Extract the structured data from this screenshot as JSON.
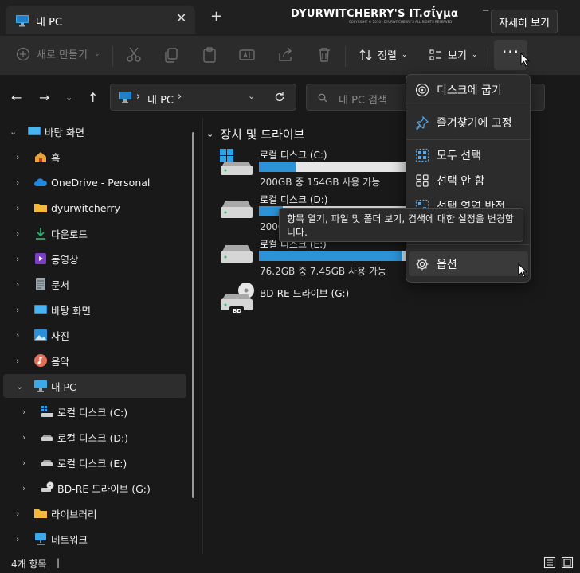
{
  "window": {
    "tab_title": "내 PC",
    "tab_close": "✕",
    "new_tab": "+",
    "brand": "DYURWITCHERRY'S IT.σΐγμα",
    "brand_sub": "COPYRIGHT © 2016 - DYURWITCHERRY'S ALL RIGHTS RESERVED",
    "tooltip_top": "자세히 보기"
  },
  "toolbar": {
    "new_label": "새로 만들기",
    "sort_label": "정렬",
    "view_label": "보기",
    "more_label": "···"
  },
  "address": {
    "location": "내 PC",
    "search_placeholder": "내 PC 검색"
  },
  "sidebar": {
    "items": [
      {
        "label": "바탕 화면",
        "icon": "desktop-icon"
      },
      {
        "label": "홈",
        "icon": "home-icon"
      },
      {
        "label": "OneDrive - Personal",
        "icon": "cloud-icon"
      },
      {
        "label": "dyurwitcherry",
        "icon": "folder-icon"
      },
      {
        "label": "다운로드",
        "icon": "download-icon"
      },
      {
        "label": "동영상",
        "icon": "video-icon"
      },
      {
        "label": "문서",
        "icon": "document-icon"
      },
      {
        "label": "바탕 화면",
        "icon": "desktop-icon"
      },
      {
        "label": "사진",
        "icon": "pictures-icon"
      },
      {
        "label": "음악",
        "icon": "music-icon"
      },
      {
        "label": "내 PC",
        "icon": "pc-icon"
      },
      {
        "label": "로컬 디스크 (C:)",
        "icon": "drive-icon"
      },
      {
        "label": "로컬 디스크 (D:)",
        "icon": "drive-icon"
      },
      {
        "label": "로컬 디스크 (E:)",
        "icon": "drive-icon"
      },
      {
        "label": "BD-RE 드라이브 (G:)",
        "icon": "optical-drive-icon"
      },
      {
        "label": "라이브러리",
        "icon": "folder-icon"
      },
      {
        "label": "네트워크",
        "icon": "network-icon"
      }
    ]
  },
  "main": {
    "group_title": "장치 및 드라이브",
    "drives": [
      {
        "name": "로컬 디스크 (C:)",
        "info": "200GB 중 154GB 사용 가능",
        "used_fraction": 0.23
      },
      {
        "name": "로컬 디스크 (D:)",
        "info": "200GB 중 ",
        "used_fraction": 0.15
      },
      {
        "name": "로컬 디스크 (E:)",
        "info": "76.2GB 중 7.45GB 사용 가능",
        "used_fraction": 0.9
      },
      {
        "name": "BD-RE 드라이브 (G:)",
        "info": "",
        "badge": "BD"
      }
    ]
  },
  "menu": {
    "items": [
      {
        "label": "디스크에 굽기",
        "icon": "burn-disc-icon"
      },
      {
        "label": "즐겨찾기에 고정",
        "icon": "pin-icon"
      },
      {
        "label": "모두 선택",
        "icon": "select-all-icon"
      },
      {
        "label": "선택 안 함",
        "icon": "select-none-icon"
      },
      {
        "label": "선택 영역 반전",
        "icon": "invert-selection-icon"
      },
      {
        "label": "옵션",
        "icon": "gear-icon"
      }
    ]
  },
  "tooltip": "항목 열기, 파일 및 폴더 보기, 검색에 대한 설정을 변경합니다.",
  "status": {
    "count": "4개 항목",
    "cursor": "|"
  },
  "colors": {
    "accent": "#2c93d6",
    "background": "#191919",
    "toolbar": "#2b2b2b"
  }
}
